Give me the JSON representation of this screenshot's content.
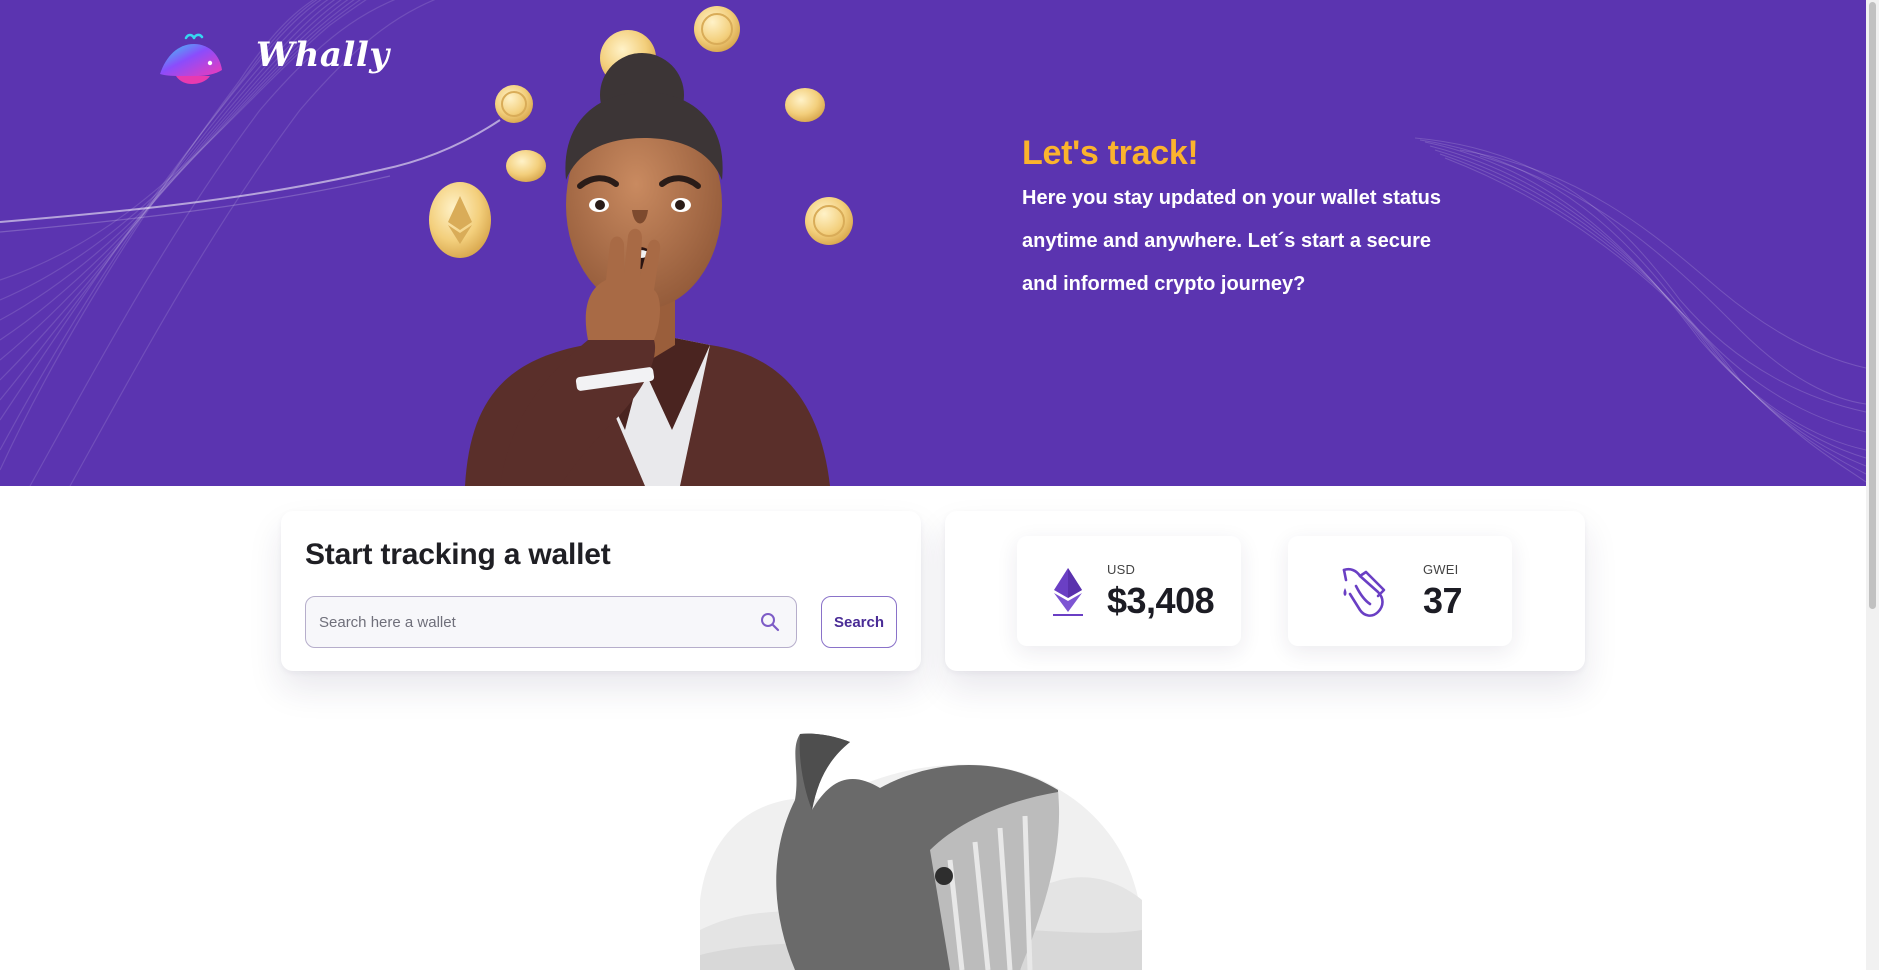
{
  "brand": {
    "name": "Whally",
    "logo_icon": "whale-logo-icon"
  },
  "hero": {
    "title": "Let's track!",
    "text": "Here you stay updated on your wallet status anytime and anywhere. Let´s start a secure and informed crypto journey?",
    "illustration": "surprised-woman-with-ethereum-coins"
  },
  "tracker": {
    "title": "Start tracking a wallet",
    "search_placeholder": "Search here a wallet",
    "search_value": "",
    "search_icon": "magnifier-icon",
    "search_button": "Search"
  },
  "stats": [
    {
      "icon": "ethereum-icon",
      "label": "USD",
      "value": "$3,408"
    },
    {
      "icon": "gas-pump-icon",
      "label": "GWEI",
      "value": "37"
    }
  ],
  "footer_illustration": "grey-whale-jumping",
  "colors": {
    "hero_bg": "#5b34b0",
    "accent_yellow": "#fbb32d",
    "accent_purple": "#6a3fc4"
  }
}
